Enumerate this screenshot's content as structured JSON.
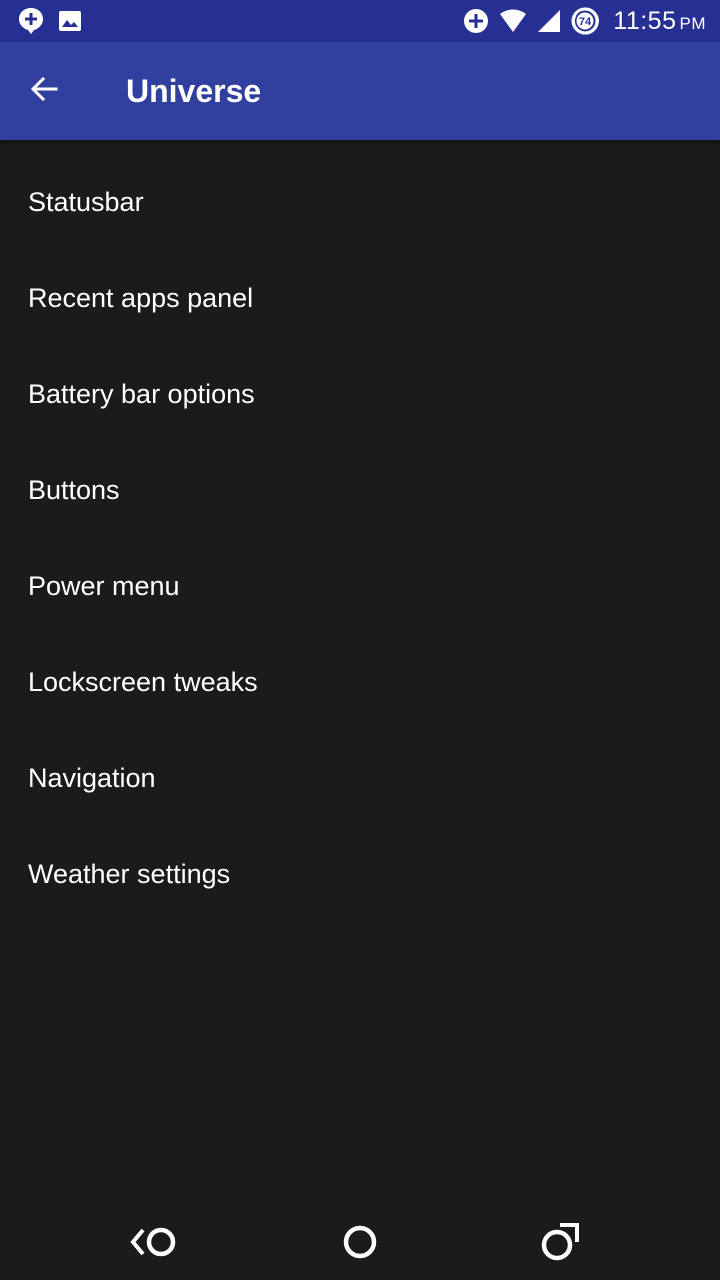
{
  "status_bar": {
    "left_icons": [
      "location-pin-plus-icon",
      "image-icon"
    ],
    "right_icons": [
      "data-saver-icon",
      "wifi-icon",
      "cell-signal-icon",
      "battery-icon"
    ],
    "battery_level": "74",
    "time": "11:55",
    "ampm": "PM",
    "background": "#263093"
  },
  "app_bar": {
    "title": "Universe",
    "back_icon": "arrow-left-icon",
    "background": "#313f9f"
  },
  "menu": {
    "items": [
      {
        "label": "Statusbar"
      },
      {
        "label": "Recent apps panel"
      },
      {
        "label": "Battery bar options"
      },
      {
        "label": "Buttons"
      },
      {
        "label": "Power menu"
      },
      {
        "label": "Lockscreen tweaks"
      },
      {
        "label": "Navigation"
      },
      {
        "label": "Weather settings"
      }
    ]
  },
  "nav_bar": {
    "buttons": [
      "back-icon",
      "home-icon",
      "recents-icon"
    ]
  },
  "colors": {
    "background": "#1b1b1b",
    "text": "#ffffff"
  }
}
